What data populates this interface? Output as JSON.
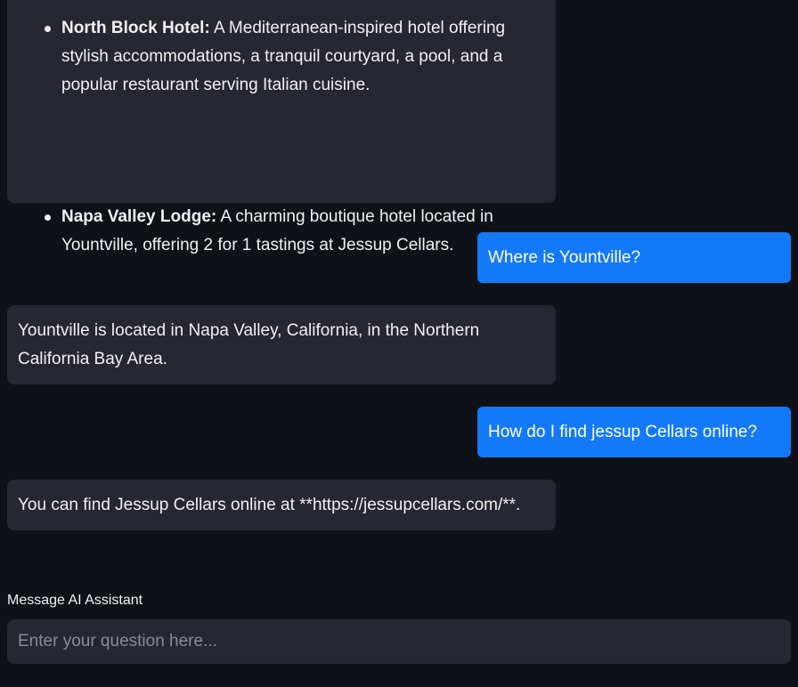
{
  "chat": {
    "messages": [
      {
        "role": "assistant",
        "items": [
          {
            "title": "North Block Hotel:",
            "text": "A Mediterranean-inspired hotel offering stylish accommodations, a tranquil courtyard, a pool, and a popular restaurant serving Italian cuisine."
          },
          {
            "title": "Napa Valley Lodge:",
            "text": "A charming boutique hotel located in Yountville, offering 2 for 1 tastings at Jessup Cellars."
          }
        ]
      },
      {
        "role": "user",
        "text": "Where is Yountville?"
      },
      {
        "role": "assistant",
        "text": "Yountville is located in Napa Valley, California, in the Northern California Bay Area."
      },
      {
        "role": "user",
        "text": "How do I find jessup Cellars online?"
      },
      {
        "role": "assistant",
        "text": "You can find Jessup Cellars online at **https://jessupcellars.com/**."
      }
    ]
  },
  "input": {
    "label": "Message AI Assistant",
    "placeholder": "Enter your question here...",
    "value": ""
  },
  "colors": {
    "background": "#0f1118",
    "assistant_bubble": "#262730",
    "user_bubble": "#1479f7",
    "text": "#f1f1f3",
    "placeholder": "#8a8c95"
  }
}
